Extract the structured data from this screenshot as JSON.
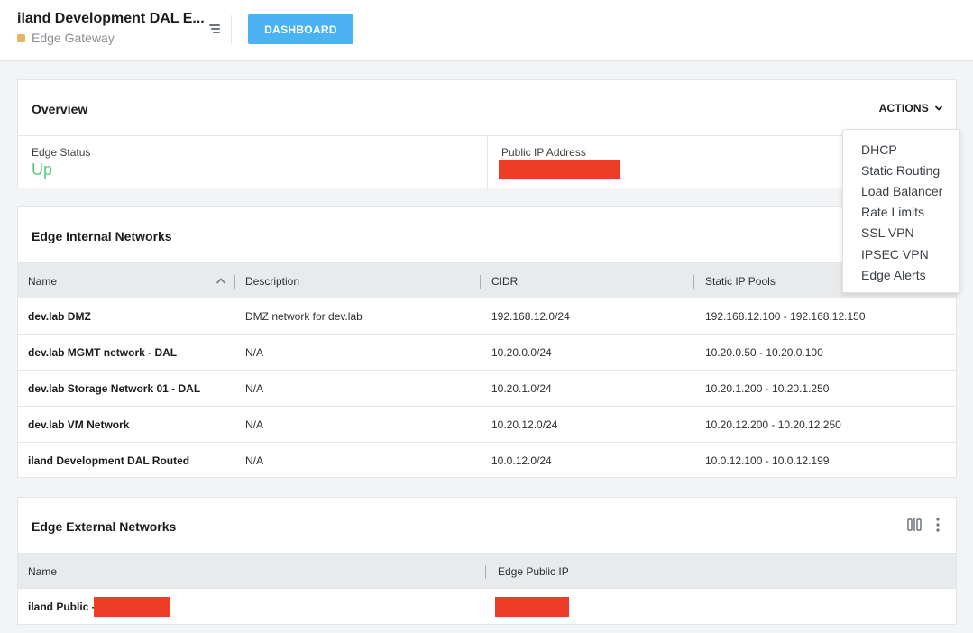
{
  "header": {
    "title": "iland Development DAL E...",
    "subtitle": "Edge Gateway",
    "dashboard_label": "DASHBOARD"
  },
  "overview": {
    "title": "Overview",
    "actions_label": "ACTIONS",
    "edge_status_label": "Edge Status",
    "edge_status_value": "Up",
    "public_ip_label": "Public IP Address"
  },
  "actions_menu": {
    "items": [
      "DHCP",
      "Static Routing",
      "Load Balancer",
      "Rate Limits",
      "SSL VPN",
      "IPSEC VPN",
      "Edge Alerts"
    ]
  },
  "internal_networks": {
    "title": "Edge Internal Networks",
    "columns": [
      "Name",
      "Description",
      "CIDR",
      "Static IP Pools"
    ],
    "rows": [
      {
        "name": "dev.lab DMZ",
        "description": "DMZ network for dev.lab",
        "cidr": "192.168.12.0/24",
        "pools": "192.168.12.100 - 192.168.12.150"
      },
      {
        "name": "dev.lab MGMT network - DAL",
        "description": "N/A",
        "cidr": "10.20.0.0/24",
        "pools": "10.20.0.50 - 10.20.0.100"
      },
      {
        "name": "dev.lab Storage Network 01 - DAL",
        "description": "N/A",
        "cidr": "10.20.1.0/24",
        "pools": "10.20.1.200 - 10.20.1.250"
      },
      {
        "name": "dev.lab VM Network",
        "description": "N/A",
        "cidr": "10.20.12.0/24",
        "pools": "10.20.12.200 - 10.20.12.250"
      },
      {
        "name": "iland Development DAL Routed",
        "description": "N/A",
        "cidr": "10.0.12.0/24",
        "pools": "10.0.12.100 - 10.0.12.199"
      }
    ]
  },
  "external_networks": {
    "title": "Edge External Networks",
    "columns": [
      "Name",
      "Edge Public IP"
    ],
    "rows": [
      {
        "name": "iland Public -"
      }
    ]
  },
  "colors": {
    "accent": "#4bb3f3",
    "status_up": "#5cc878",
    "redaction": "#ee3d26",
    "gateway_badge": "#e0b663"
  },
  "icons": [
    "hamburger-menu-icon",
    "chevron-down-icon",
    "sort-ascending-icon",
    "column-toggle-icon",
    "more-vertical-icon"
  ]
}
